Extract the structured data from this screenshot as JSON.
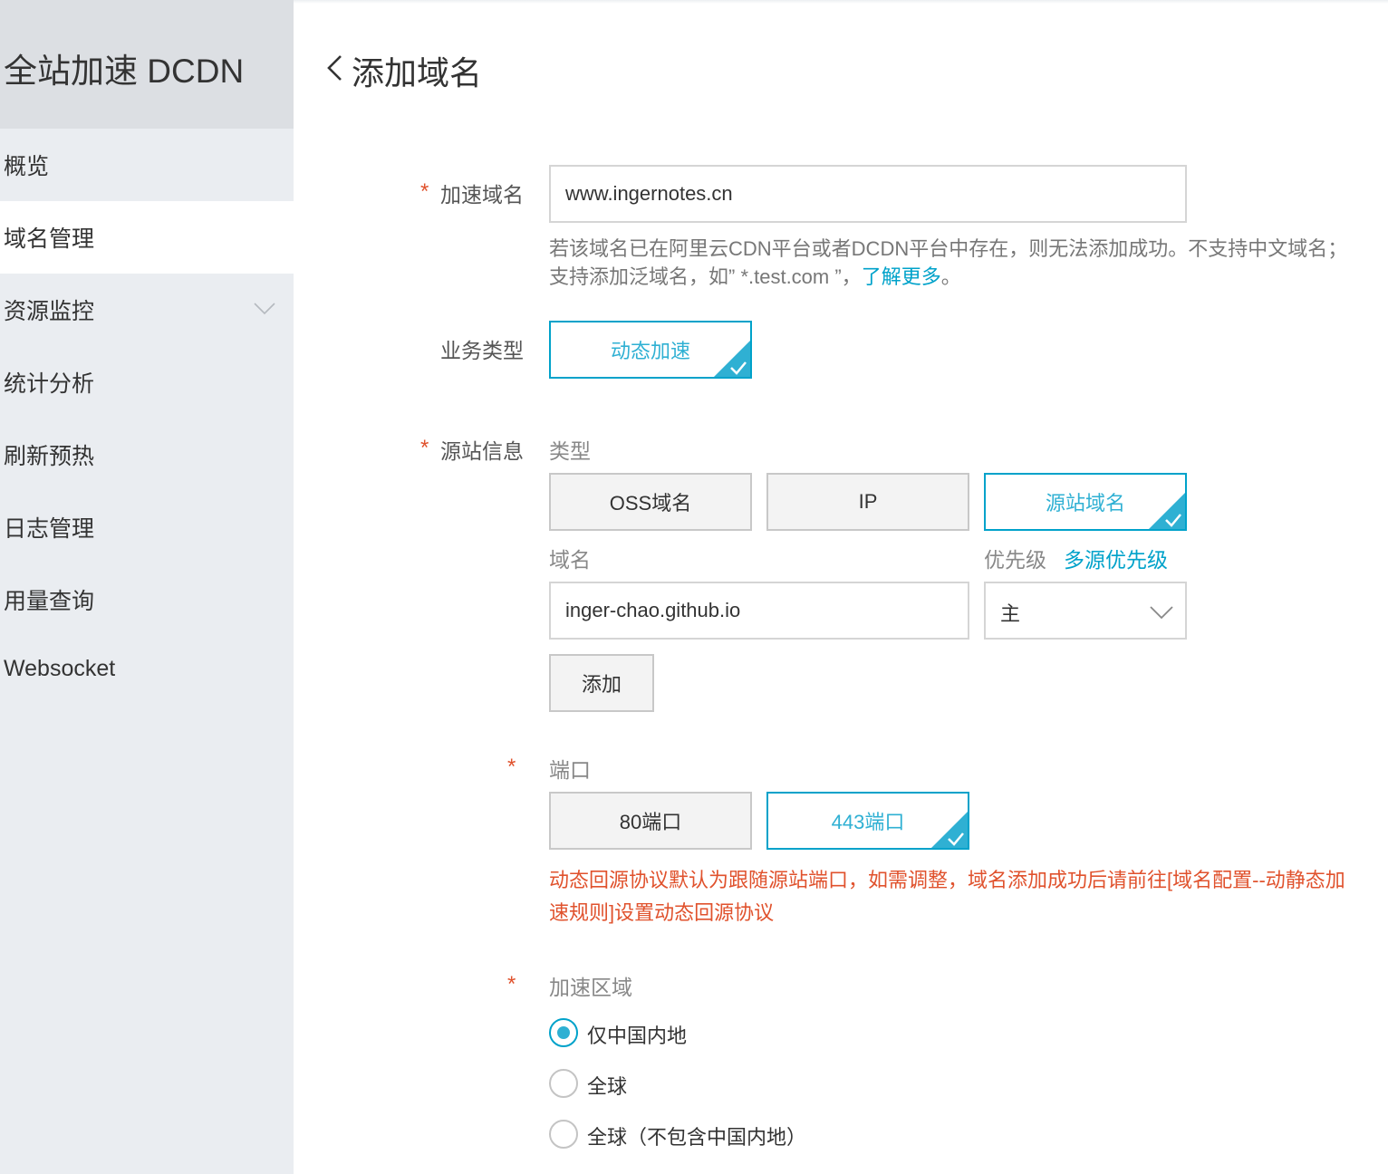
{
  "sidebar": {
    "title": "全站加速 DCDN",
    "items": [
      {
        "label": "概览"
      },
      {
        "label": "域名管理"
      },
      {
        "label": "资源监控"
      },
      {
        "label": "统计分析"
      },
      {
        "label": "刷新预热"
      },
      {
        "label": "日志管理"
      },
      {
        "label": "用量查询"
      },
      {
        "label": "Websocket"
      }
    ]
  },
  "page": {
    "title": "添加域名"
  },
  "form": {
    "required_mark": "*",
    "domain": {
      "label": "加速域名",
      "value": "www.ingernotes.cn",
      "help_text": "若该域名已在阿里云CDN平台或者DCDN平台中存在，则无法添加成功。不支持中文域名；支持添加泛域名，如” *.test.com ”，",
      "help_link": "了解更多",
      "help_end": "。"
    },
    "business_type": {
      "label": "业务类型",
      "option": "动态加速"
    },
    "origin": {
      "label": "源站信息",
      "type_label": "类型",
      "types": [
        "OSS域名",
        "IP",
        "源站域名"
      ],
      "domain_label": "域名",
      "priority_label": "优先级",
      "priority_link": "多源优先级",
      "domain_value": "inger-chao.github.io",
      "priority_value": "主",
      "add_button": "添加"
    },
    "port": {
      "label": "端口",
      "options": [
        "80端口",
        "443端口"
      ],
      "warning": "动态回源协议默认为跟随源站端口，如需调整，域名添加成功后请前往[域名配置--动静态加速规则]设置动态回源协议"
    },
    "region": {
      "label": "加速区域",
      "options": [
        "仅中国内地",
        "全球",
        "全球（不包含中国内地）"
      ],
      "selected": "仅中国内地"
    }
  },
  "colors": {
    "accent": "#00a2ca",
    "required": "#e0522d",
    "brand_bar": "#ff6a00"
  }
}
